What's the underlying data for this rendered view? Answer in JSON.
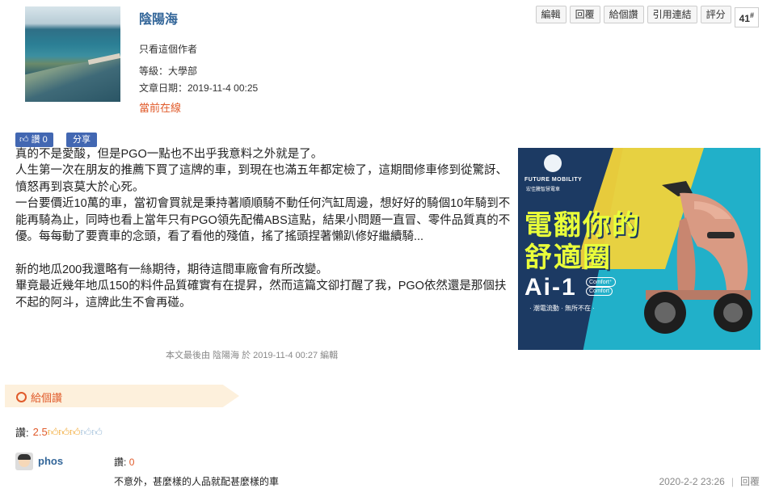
{
  "author": {
    "name": "陰陽海",
    "view_only": "只看這個作者",
    "level": "等級：大學部",
    "post_date": "文章日期：2019-11-4 00:25",
    "status": "當前在線"
  },
  "toolbar": {
    "edit": "編輯",
    "reply": "回覆",
    "like": "給個讚",
    "quote_link": "引用連結",
    "rate": "評分",
    "floor": "41",
    "floor_mark": "#"
  },
  "social": {
    "like_label": "讚 0",
    "share_label": "分享"
  },
  "post": {
    "paragraphs": [
      "真的不是愛酸，但是PGO一點也不出乎我意料之外就是了。",
      "人生第一次在朋友的推薦下買了這牌的車，到現在也滿五年都定檢了，這期間修車修到從驚訝、憤怒再到哀莫大於心死。",
      "一台要價近10萬的車，當初會買就是秉持著順順騎不動任何汽缸周邊，想好好的騎個10年騎到不能再騎為止，同時也看上當年只有PGO領先配備ABS這點，結果小問題一直冒、零件品質真的不優。每每動了要賣車的念頭，看了看他的殘值，搖了搖頭捏著懶趴修好繼續騎...",
      "",
      "新的地瓜200我還略有一絲期待，期待這間車廠會有所改變。",
      "畢竟最近幾年地瓜150的料件品質確實有在提昇，然而這篇文卻打醒了我，PGO依然還是那個扶不起的阿斗，這牌此生不會再碰。"
    ],
    "edited_note": "本文最後由 陰陽海 於 2019-11-4 00:27 編輯"
  },
  "ad": {
    "brand": "FUTURE MOBILITY",
    "brand_sub": "宏佳騰智慧電車",
    "headline_1": "電翻你的",
    "headline_2": "舒適圈",
    "model": "Ai-1",
    "comfort_plus": "Comfort⁺",
    "comfort": "Comfort",
    "tagline": "· 潮電流動 · 無所不在 ·"
  },
  "give_like": {
    "label": "給個讚"
  },
  "score": {
    "label": "讚:",
    "value": "2.5",
    "rating": 2.5,
    "max": 5
  },
  "comment": {
    "user": "phos",
    "score_label": "讚:",
    "score_value": "0",
    "text": "不意外，甚麼樣的人品就配甚麼樣的車",
    "time": "2020-2-2 23:26",
    "reply": "回覆"
  },
  "colors": {
    "link_blue": "#336699",
    "accent_orange": "#e05a2a",
    "fb_blue": "#4267b2"
  }
}
